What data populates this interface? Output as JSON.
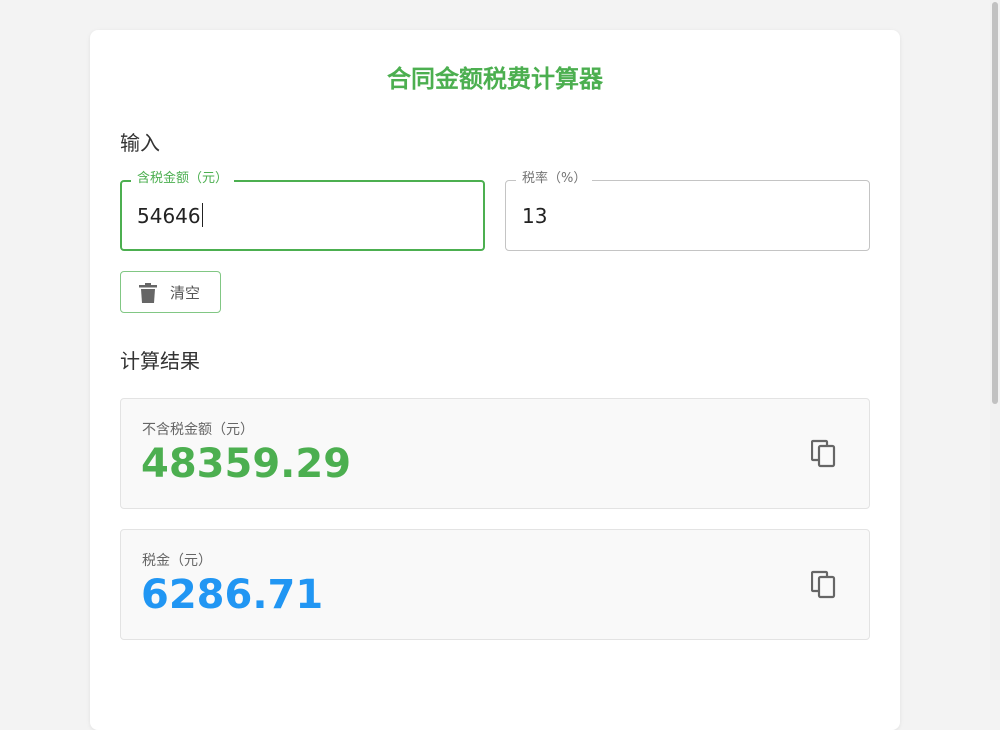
{
  "app": {
    "title": "合同金额税费计算器"
  },
  "input_section": {
    "heading": "输入",
    "amount_field": {
      "label": "含税金额（元）",
      "value": "54646"
    },
    "rate_field": {
      "label": "税率（%）",
      "value": "13"
    },
    "clear_button": {
      "label": "清空",
      "icon": "trash-icon"
    }
  },
  "result_section": {
    "heading": "计算结果",
    "pre_tax_amount": {
      "label": "不含税金额（元）",
      "value": "48359.29",
      "color": "#4caf50",
      "copy_icon": "copy-icon"
    },
    "tax_amount": {
      "label": "税金（元）",
      "value": "6286.71",
      "color": "#2196f3",
      "copy_icon": "copy-icon"
    }
  },
  "theme": {
    "accent": "#4caf50",
    "secondary": "#2196f3"
  }
}
